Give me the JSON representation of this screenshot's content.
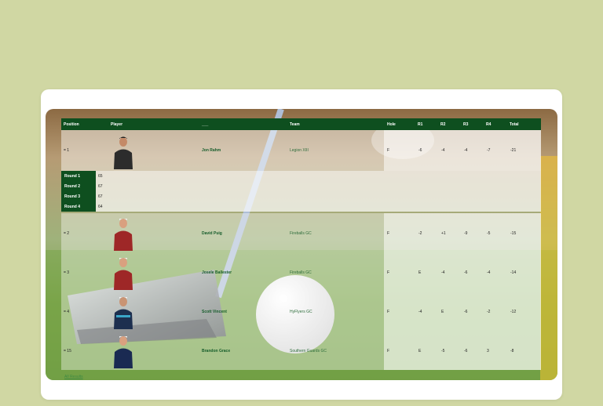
{
  "leaderboard": {
    "columns": [
      "Position",
      "Player",
      "___",
      "Team",
      "Hole",
      "R1",
      "R2",
      "R3",
      "R4",
      "Total"
    ],
    "rows": [
      {
        "position": "= 1",
        "player": "Jon Rahm",
        "team": "Legion XIII",
        "hole": "F",
        "r1": "-6",
        "r2": "-4",
        "r3": "-4",
        "r4": "-7",
        "total": "-21",
        "rounds": [
          {
            "label": "Round 1",
            "score": "65"
          },
          {
            "label": "Round 2",
            "score": "67"
          },
          {
            "label": "Round 3",
            "score": "67"
          },
          {
            "label": "Round 4",
            "score": "64"
          }
        ],
        "shirt": "#2c2c2c"
      },
      {
        "position": "= 2",
        "player": "David Puig",
        "team": "Fireballs GC",
        "hole": "F",
        "r1": "-2",
        "r2": "+1",
        "r3": "-9",
        "r4": "-5",
        "total": "-15",
        "shirt": "#9e2727"
      },
      {
        "position": "= 3",
        "player": "Josele Ballester",
        "team": "Fireballs GC",
        "hole": "F",
        "r1": "E",
        "r2": "-4",
        "r3": "-6",
        "r4": "-4",
        "total": "-14",
        "shirt": "#9e2727"
      },
      {
        "position": "= 4",
        "player": "Scott Vincent",
        "team": "HyFlyers GC",
        "hole": "F",
        "r1": "-4",
        "r2": "E",
        "r3": "-6",
        "r4": "-2",
        "total": "-12",
        "shirt": "#1d2f4f"
      },
      {
        "position": "= 15",
        "player": "Brandon Grace",
        "team": "Southern Guards GC",
        "hole": "F",
        "r1": "E",
        "r2": "-5",
        "r3": "-6",
        "r4": "3",
        "total": "-8",
        "shirt": "#1a2a52"
      }
    ]
  },
  "footer": {
    "link_text": "All Results"
  },
  "colors": {
    "page_bg": "#d0d7a3",
    "header_green": "#0e4f1f",
    "player_green": "#155c2a"
  },
  "icons": {
    "player_photo": "avatar-icon"
  }
}
